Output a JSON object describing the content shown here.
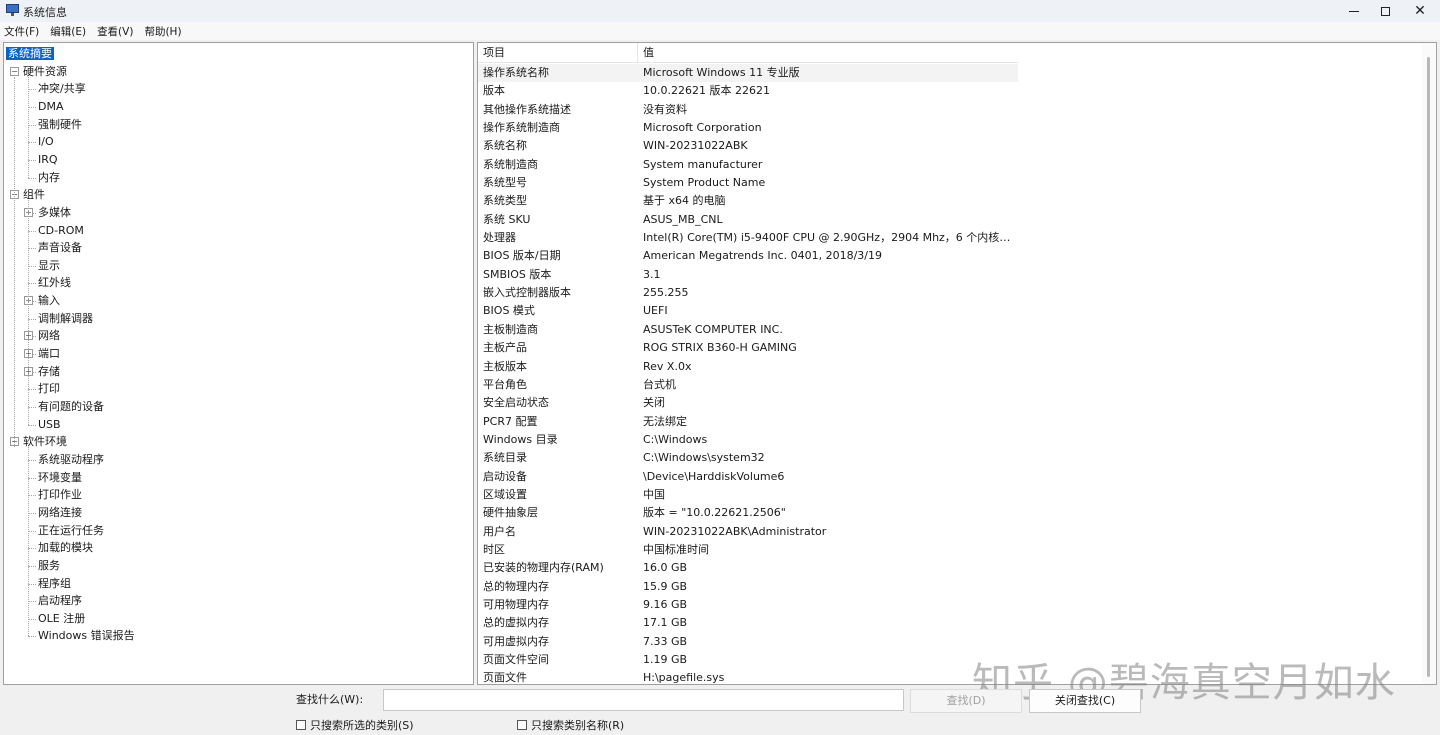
{
  "window": {
    "title": "系统信息",
    "icon": "system-info-icon",
    "controls": {
      "minimize": "minimize-icon",
      "maximize": "maximize-icon",
      "close": "✕"
    }
  },
  "menubar": [
    "文件(F)",
    "编辑(E)",
    "查看(V)",
    "帮助(H)"
  ],
  "tree": [
    {
      "label": "系统摘要",
      "level": 0,
      "selected": true
    },
    {
      "label": "硬件资源",
      "level": 0,
      "expander": "⊟"
    },
    {
      "label": "冲突/共享",
      "level": 1
    },
    {
      "label": "DMA",
      "level": 1
    },
    {
      "label": "强制硬件",
      "level": 1
    },
    {
      "label": "I/O",
      "level": 1
    },
    {
      "label": "IRQ",
      "level": 1
    },
    {
      "label": "内存",
      "level": 1
    },
    {
      "label": "组件",
      "level": 0,
      "expander": "⊟"
    },
    {
      "label": "多媒体",
      "level": 1,
      "expander": "⊞"
    },
    {
      "label": "CD-ROM",
      "level": 1
    },
    {
      "label": "声音设备",
      "level": 1
    },
    {
      "label": "显示",
      "level": 1
    },
    {
      "label": "红外线",
      "level": 1
    },
    {
      "label": "输入",
      "level": 1,
      "expander": "⊞"
    },
    {
      "label": "调制解调器",
      "level": 1
    },
    {
      "label": "网络",
      "level": 1,
      "expander": "⊞"
    },
    {
      "label": "端口",
      "level": 1,
      "expander": "⊞"
    },
    {
      "label": "存储",
      "level": 1,
      "expander": "⊞"
    },
    {
      "label": "打印",
      "level": 1
    },
    {
      "label": "有问题的设备",
      "level": 1
    },
    {
      "label": "USB",
      "level": 1
    },
    {
      "label": "软件环境",
      "level": 0,
      "expander": "⊟"
    },
    {
      "label": "系统驱动程序",
      "level": 1
    },
    {
      "label": "环境变量",
      "level": 1
    },
    {
      "label": "打印作业",
      "level": 1
    },
    {
      "label": "网络连接",
      "level": 1
    },
    {
      "label": "正在运行任务",
      "level": 1
    },
    {
      "label": "加载的模块",
      "level": 1
    },
    {
      "label": "服务",
      "level": 1
    },
    {
      "label": "程序组",
      "level": 1
    },
    {
      "label": "启动程序",
      "level": 1
    },
    {
      "label": "OLE 注册",
      "level": 1
    },
    {
      "label": "Windows 错误报告",
      "level": 1
    }
  ],
  "list": {
    "columns": [
      "项目",
      "值"
    ],
    "rows": [
      [
        "操作系统名称",
        "Microsoft Windows 11 专业版"
      ],
      [
        "版本",
        "10.0.22621 版本 22621"
      ],
      [
        "其他操作系统描述",
        "没有资料"
      ],
      [
        "操作系统制造商",
        "Microsoft Corporation"
      ],
      [
        "系统名称",
        "WIN-20231022ABK"
      ],
      [
        "系统制造商",
        "System manufacturer"
      ],
      [
        "系统型号",
        "System Product Name"
      ],
      [
        "系统类型",
        "基于 x64 的电脑"
      ],
      [
        "系统 SKU",
        "ASUS_MB_CNL"
      ],
      [
        "处理器",
        "Intel(R) Core(TM) i5-9400F CPU @ 2.90GHz，2904 Mhz，6 个内核，6 个..."
      ],
      [
        "BIOS 版本/日期",
        "American Megatrends Inc. 0401, 2018/3/19"
      ],
      [
        "SMBIOS 版本",
        "3.1"
      ],
      [
        "嵌入式控制器版本",
        "255.255"
      ],
      [
        "BIOS 模式",
        "UEFI"
      ],
      [
        "主板制造商",
        "ASUSTeK COMPUTER INC."
      ],
      [
        "主板产品",
        "ROG STRIX B360-H GAMING"
      ],
      [
        "主板版本",
        "Rev X.0x"
      ],
      [
        "平台角色",
        "台式机"
      ],
      [
        "安全启动状态",
        "关闭"
      ],
      [
        "PCR7 配置",
        "无法绑定"
      ],
      [
        "Windows 目录",
        "C:\\Windows"
      ],
      [
        "系统目录",
        "C:\\Windows\\system32"
      ],
      [
        "启动设备",
        "\\Device\\HarddiskVolume6"
      ],
      [
        "区域设置",
        "中国"
      ],
      [
        "硬件抽象层",
        "版本 = \"10.0.22621.2506\""
      ],
      [
        "用户名",
        "WIN-20231022ABK\\Administrator"
      ],
      [
        "时区",
        "中国标准时间"
      ],
      [
        "已安装的物理内存(RAM)",
        "16.0 GB"
      ],
      [
        "总的物理内存",
        "15.9 GB"
      ],
      [
        "可用物理内存",
        "9.16 GB"
      ],
      [
        "总的虚拟内存",
        "17.1 GB"
      ],
      [
        "可用虚拟内存",
        "7.33 GB"
      ],
      [
        "页面文件空间",
        "1.19 GB"
      ],
      [
        "页面文件",
        "H:\\pagefile.sys"
      ]
    ]
  },
  "watermark": "知乎 @碧海真空月如水",
  "search": {
    "label": "查找什么(W):",
    "value": "",
    "find_button": "查找(D)",
    "close_find_button": "关闭查找(C)",
    "checkbox_selected_category": "只搜索所选的类别(S)",
    "checkbox_category_names": "只搜索类别名称(R)"
  },
  "colors": {
    "selection": "#0a64c8",
    "window_bg": "#f0f0f0"
  }
}
